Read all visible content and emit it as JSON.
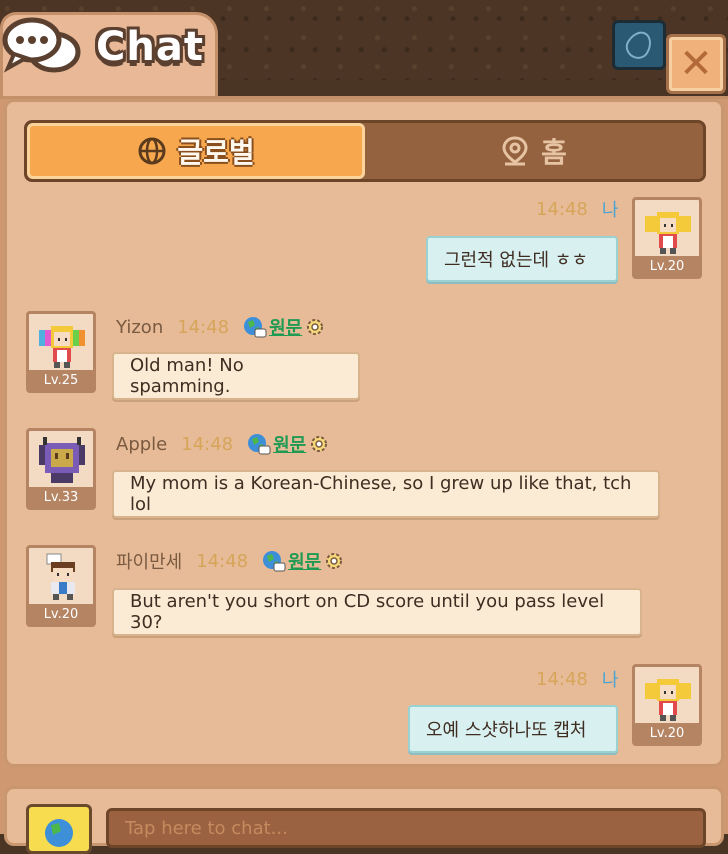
{
  "header": {
    "title": "Chat",
    "close_label": "✕"
  },
  "tabs": [
    {
      "label": "글로벌",
      "icon": "globe-icon",
      "active": true
    },
    {
      "label": "홈",
      "icon": "location-pin-icon",
      "active": false
    }
  ],
  "messages": [
    {
      "sender": "나",
      "time": "14:48",
      "text": "그런적 없는데 ㅎㅎ",
      "level": "Lv.20",
      "mine": true
    },
    {
      "sender": "Yizon",
      "time": "14:48",
      "original_label": "원문",
      "text": "Old man! No spamming.",
      "level": "Lv.25",
      "mine": false
    },
    {
      "sender": "Apple",
      "time": "14:48",
      "original_label": "원문",
      "text": "My mom is a Korean-Chinese, so I grew up like that, tch lol",
      "level": "Lv.33",
      "mine": false
    },
    {
      "sender": "파이만세",
      "time": "14:48",
      "original_label": "원문",
      "text": "But aren't you short on CD score until you pass level 30?",
      "level": "Lv.20",
      "mine": false
    },
    {
      "sender": "나",
      "time": "14:48",
      "text": "오예 스샷하나또 캡처",
      "level": "Lv.20",
      "mine": true
    }
  ],
  "input": {
    "placeholder": "Tap here to chat..."
  },
  "colors": {
    "accent_tab": "#f7a74d",
    "panel": "#e7bb97",
    "my_bubble": "#d8f0f0",
    "other_bubble": "#fbebd5",
    "time": "#d6a55a",
    "original_link": "#1f9a53"
  }
}
